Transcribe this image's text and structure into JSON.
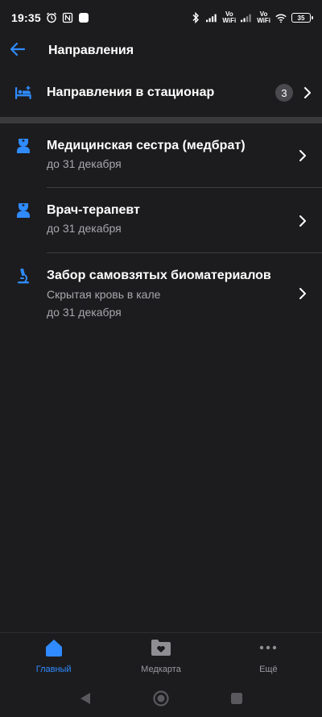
{
  "status_bar": {
    "time": "19:35",
    "battery": "35",
    "volte1_top": "Vo",
    "volte1_bottom": "WiFi",
    "volte2_top": "Vo",
    "volte2_bottom": "WiFi"
  },
  "header": {
    "title": "Направления",
    "back_icon": "arrow-left-icon"
  },
  "hospital": {
    "label": "Направления в стационар",
    "count": "3",
    "icon": "hospital-bed-icon"
  },
  "items": [
    {
      "title": "Медицинская сестра (медбрат)",
      "date": "до 31 декабря",
      "icon": "nurse-icon"
    },
    {
      "title": "Врач-терапевт",
      "date": "до 31 декабря",
      "icon": "nurse-icon"
    },
    {
      "title": "Забор самовзятых биоматериалов",
      "subtitle": "Скрытая кровь в кале",
      "date": "до 31 декабря",
      "icon": "microscope-icon"
    }
  ],
  "bottom_nav": [
    {
      "label": "Главный",
      "icon": "home-icon",
      "active": true
    },
    {
      "label": "Медкарта",
      "icon": "folder-heart-icon",
      "active": false
    },
    {
      "label": "Ещё",
      "icon": "more-dots-icon",
      "active": false
    }
  ],
  "colors": {
    "background": "#1c1c1e",
    "accent": "#2f8bff",
    "secondary_text": "#a8a8ad",
    "separator": "#3a3a3c"
  }
}
